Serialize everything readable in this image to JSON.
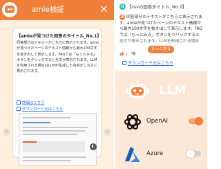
{
  "left_panel": {
    "header_title": "amie検証",
    "close_label": "×",
    "bubble": {
      "title": "【amieが見つけた回答のタイトル_No.1】",
      "body": "回答部分のテキストがこちらに表示されます。amieが見つけたページのテキスト情報から最大100文字を抜き出して表示します。FAQでは「もっとみる」ボタンをクリックすると全文が表示されます。LLMを利用される場合はLLMが生成した内容がこちらに表示されます。",
      "detail_link": "詳細はこちら",
      "download_link": "ダウンロード元はこちら"
    },
    "nav_prev": "‹",
    "nav_next": "›"
  },
  "right_panel": {
    "faq_card": {
      "question_badge": "Q",
      "question_title": "【csvの回答タイトル_No.3】",
      "answer_badge": "A",
      "answer_text": "回答部分のテキストがこちらに表示されます。amieが見つけたページのテキスト情報から最大100文字を抜き出して表示します。FAQでは「もっとみる」ボタンをクリックすると全文が表示されます。LLMを利用される場合",
      "more_button": "もっと見る",
      "likes": "1",
      "download_link": "ダウンロード元はこちら"
    },
    "llm_label": "LLM",
    "providers": [
      {
        "name": "OpenAI",
        "enabled": true
      },
      {
        "name": "Azure",
        "enabled": false
      }
    ]
  },
  "colors": {
    "brand_orange": "#f07f3a",
    "left_background": "#fdf0dd",
    "right_background": "#fde8d8",
    "link_blue": "#2a6bd6",
    "azure_blue": "#1d74c9",
    "question_teal": "#2bb7a9"
  },
  "icons": {
    "header_avatar": "robot-avatar-icon",
    "detail_link": "external-link-icon",
    "download": "download-icon",
    "llm": "robot-icon",
    "openai": "openai-logo-icon",
    "azure": "azure-logo-icon",
    "like": "thumbs-up-icon",
    "dislike": "thumbs-down-icon"
  }
}
